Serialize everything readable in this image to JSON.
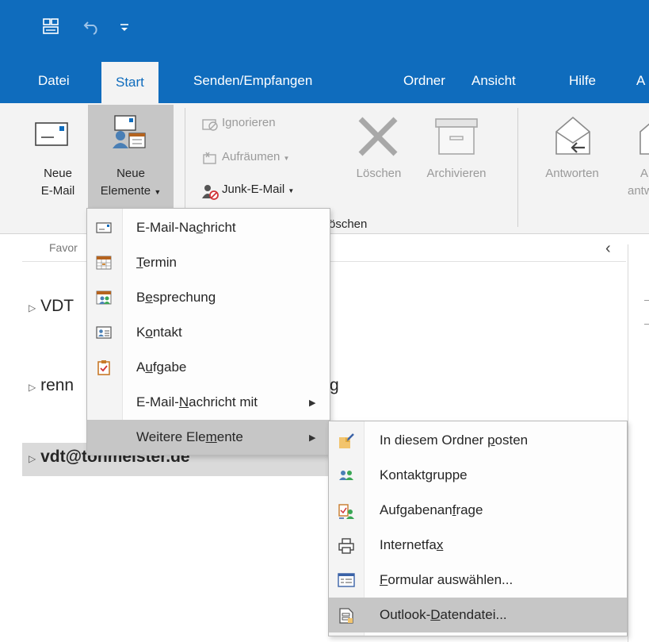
{
  "tabs": [
    {
      "label": "Datei"
    },
    {
      "label": "Start"
    },
    {
      "label": "Senden/Empfangen"
    },
    {
      "label": "Ordner"
    },
    {
      "label": "Ansicht"
    },
    {
      "label": "Hilfe"
    },
    {
      "label": "A"
    }
  ],
  "ribbon": {
    "neue_email": {
      "line1": "Neue",
      "line2": "E-Mail"
    },
    "neue_elemente": {
      "line1": "Neue",
      "line2": "Elemente"
    },
    "ignorieren": "Ignorieren",
    "aufraeumen": "Aufräumen",
    "junk": "Junk-E-Mail",
    "loeschen": "Löschen",
    "archivieren": "Archivieren",
    "antworten": "Antworten",
    "next_partial": {
      "line1": "A",
      "line2": "antw"
    },
    "group_label_partial": "öschen"
  },
  "folder_pane": {
    "favorites_partial": "Favor",
    "collapse_glyph": "‹",
    "folders": [
      {
        "label_partial": "VDT"
      },
      {
        "label_partial": "renn",
        "tail": "g"
      },
      {
        "label_partial": "vdt@tonmeister.de",
        "selected": true
      }
    ]
  },
  "menu_new_items": {
    "items": [
      {
        "pre": "E-Mail-Na",
        "ul": "c",
        "post": "hricht"
      },
      {
        "pre": "",
        "ul": "T",
        "post": "ermin"
      },
      {
        "pre": "B",
        "ul": "e",
        "post": "sprechung"
      },
      {
        "pre": "K",
        "ul": "o",
        "post": "ntakt"
      },
      {
        "pre": "A",
        "ul": "u",
        "post": "fgabe"
      },
      {
        "pre": "E-Mail-",
        "ul": "N",
        "post": "achricht mit"
      },
      {
        "pre": "Weitere Ele",
        "ul": "m",
        "post": "ente"
      }
    ]
  },
  "menu_more_items": {
    "items": [
      {
        "pre": "In diesem Ordner ",
        "ul": "p",
        "post": "osten"
      },
      {
        "pre": "Kontakt",
        "ul": "g",
        "post": "ruppe"
      },
      {
        "pre": "Aufgabenan",
        "ul": "f",
        "post": "rage"
      },
      {
        "pre": "Internetfa",
        "ul": "x",
        "post": ""
      },
      {
        "pre": "",
        "ul": "F",
        "post": "ormular auswählen..."
      },
      {
        "pre": "Outlook-",
        "ul": "D",
        "post": "atendatei..."
      }
    ]
  },
  "colors": {
    "brand": "#0f6cbd",
    "ribbon": "#f3f3f3",
    "highlight": "#c6c6c6"
  }
}
